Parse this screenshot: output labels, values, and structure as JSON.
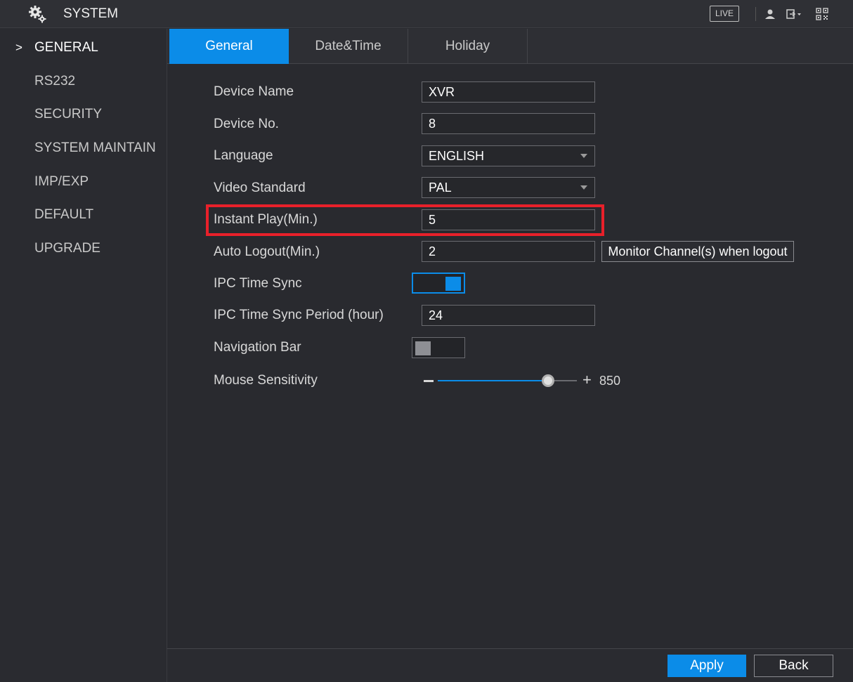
{
  "header": {
    "title": "SYSTEM",
    "icon": "gears-icon",
    "live_label": "LIVE",
    "right_icons": [
      "user-icon",
      "logout-icon",
      "qr-code-icon"
    ]
  },
  "sidebar": {
    "items": [
      {
        "label": "GENERAL",
        "active": true
      },
      {
        "label": "RS232"
      },
      {
        "label": "SECURITY"
      },
      {
        "label": "SYSTEM MAINTAIN"
      },
      {
        "label": "IMP/EXP"
      },
      {
        "label": "DEFAULT"
      },
      {
        "label": "UPGRADE"
      }
    ],
    "active_marker": ">"
  },
  "tabs": [
    {
      "label": "General",
      "active": true
    },
    {
      "label": "Date&Time"
    },
    {
      "label": "Holiday"
    }
  ],
  "form": {
    "device_name": {
      "label": "Device Name",
      "value": "XVR"
    },
    "device_no": {
      "label": "Device No.",
      "value": "8"
    },
    "language": {
      "label": "Language",
      "value": "ENGLISH"
    },
    "video_standard": {
      "label": "Video Standard",
      "value": "PAL"
    },
    "instant_play": {
      "label": "Instant Play(Min.)",
      "value": "5"
    },
    "auto_logout": {
      "label": "Auto Logout(Min.)",
      "value": "2",
      "button": "Monitor Channel(s) when logout"
    },
    "ipc_time_sync": {
      "label": "IPC Time Sync",
      "enabled": true
    },
    "ipc_time_sync_period": {
      "label": "IPC Time Sync Period (hour)",
      "value": "24"
    },
    "navigation_bar": {
      "label": "Navigation Bar",
      "enabled": false
    },
    "mouse_sensitivity": {
      "label": "Mouse Sensitivity",
      "minus": "–",
      "plus": "+",
      "value": "850",
      "level_fraction": 0.79
    }
  },
  "footer": {
    "apply_label": "Apply",
    "back_label": "Back"
  },
  "colors": {
    "accent": "#0b8ce8",
    "highlight": "#e8202a",
    "background": "#292a2f"
  }
}
